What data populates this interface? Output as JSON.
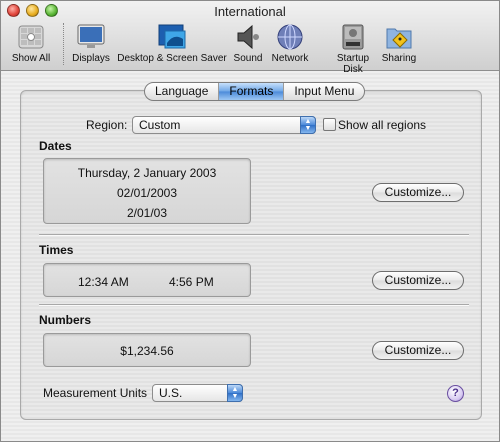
{
  "window": {
    "title": "International"
  },
  "toolbar": {
    "items": [
      {
        "label": "Show All",
        "icon": "apple-icon"
      },
      {
        "label": "Displays",
        "icon": "display-icon"
      },
      {
        "label": "Desktop & Screen Saver",
        "icon": "desktop-icon"
      },
      {
        "label": "Sound",
        "icon": "speaker-icon"
      },
      {
        "label": "Network",
        "icon": "network-globe-icon"
      },
      {
        "label": "Startup Disk",
        "icon": "disk-icon"
      },
      {
        "label": "Sharing",
        "icon": "sharing-folder-icon"
      }
    ]
  },
  "tabs": [
    {
      "label": "Language",
      "active": false
    },
    {
      "label": "Formats",
      "active": true
    },
    {
      "label": "Input Menu",
      "active": false
    }
  ],
  "region": {
    "label": "Region:",
    "value": "Custom",
    "show_all_label": "Show all regions",
    "show_all_checked": false
  },
  "dates": {
    "heading": "Dates",
    "samples": [
      "Thursday, 2 January 2003",
      "02/01/2003",
      "2/01/03"
    ],
    "customize_label": "Customize..."
  },
  "times": {
    "heading": "Times",
    "samples": [
      "12:34 AM",
      "4:56 PM"
    ],
    "customize_label": "Customize..."
  },
  "numbers": {
    "heading": "Numbers",
    "sample": "$1,234.56",
    "customize_label": "Customize..."
  },
  "measurement": {
    "label": "Measurement Units",
    "value": "U.S."
  },
  "help": {
    "label": "?"
  },
  "colors": {
    "accent": "#4b8ad9",
    "window_bg": "#ececec"
  }
}
